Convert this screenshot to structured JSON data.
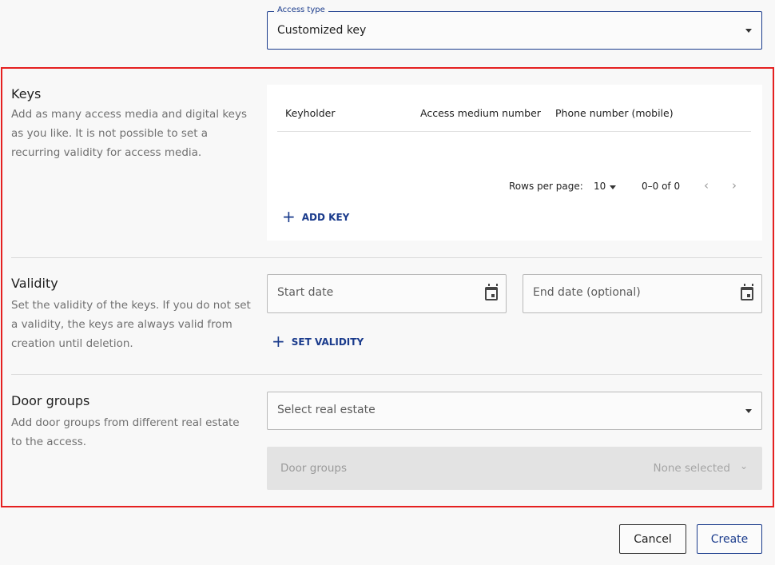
{
  "access_type": {
    "label": "Access type",
    "value": "Customized key"
  },
  "keys": {
    "title": "Keys",
    "description": "Add as many access media and digital keys as you like. It is not possible to set a recurring validity for access media.",
    "columns": [
      "Keyholder",
      "Access medium number",
      "Phone number (mobile)"
    ],
    "rows": [],
    "pagination": {
      "rows_per_page_label": "Rows per page:",
      "rows_per_page": "10",
      "range": "0–0 of 0"
    },
    "add_key_label": "ADD KEY"
  },
  "validity": {
    "title": "Validity",
    "description": "Set the validity of the keys. If you do not set a validity, the keys are always valid from creation until deletion.",
    "start_placeholder": "Start date",
    "end_placeholder": "End date (optional)",
    "set_validity_label": "SET VALIDITY"
  },
  "door_groups": {
    "title": "Door groups",
    "description": "Add door groups from different real estate to the access.",
    "real_estate_placeholder": "Select real estate",
    "door_groups_label": "Door groups",
    "door_groups_value": "None selected"
  },
  "footer": {
    "cancel_label": "Cancel",
    "create_label": "Create"
  },
  "colors": {
    "accent": "#1a3b8c",
    "highlight": "#e52020"
  }
}
